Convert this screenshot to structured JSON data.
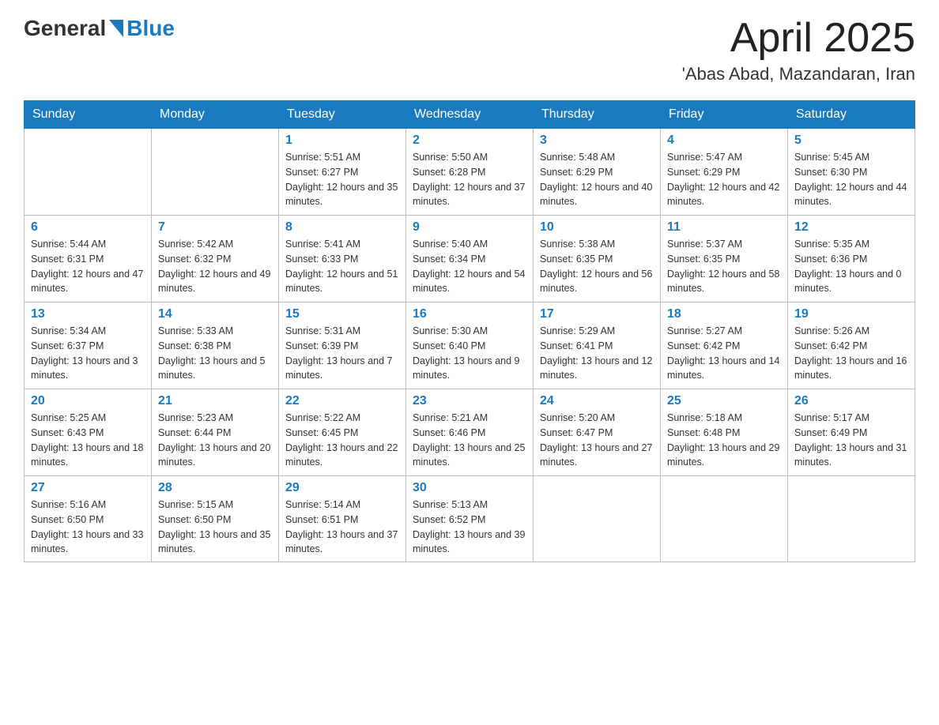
{
  "header": {
    "logo_general": "General",
    "logo_blue": "Blue",
    "month_title": "April 2025",
    "location": "'Abas Abad, Mazandaran, Iran"
  },
  "weekdays": [
    "Sunday",
    "Monday",
    "Tuesday",
    "Wednesday",
    "Thursday",
    "Friday",
    "Saturday"
  ],
  "weeks": [
    [
      null,
      null,
      {
        "day": "1",
        "sunrise": "5:51 AM",
        "sunset": "6:27 PM",
        "daylight": "12 hours and 35 minutes."
      },
      {
        "day": "2",
        "sunrise": "5:50 AM",
        "sunset": "6:28 PM",
        "daylight": "12 hours and 37 minutes."
      },
      {
        "day": "3",
        "sunrise": "5:48 AM",
        "sunset": "6:29 PM",
        "daylight": "12 hours and 40 minutes."
      },
      {
        "day": "4",
        "sunrise": "5:47 AM",
        "sunset": "6:29 PM",
        "daylight": "12 hours and 42 minutes."
      },
      {
        "day": "5",
        "sunrise": "5:45 AM",
        "sunset": "6:30 PM",
        "daylight": "12 hours and 44 minutes."
      }
    ],
    [
      {
        "day": "6",
        "sunrise": "5:44 AM",
        "sunset": "6:31 PM",
        "daylight": "12 hours and 47 minutes."
      },
      {
        "day": "7",
        "sunrise": "5:42 AM",
        "sunset": "6:32 PM",
        "daylight": "12 hours and 49 minutes."
      },
      {
        "day": "8",
        "sunrise": "5:41 AM",
        "sunset": "6:33 PM",
        "daylight": "12 hours and 51 minutes."
      },
      {
        "day": "9",
        "sunrise": "5:40 AM",
        "sunset": "6:34 PM",
        "daylight": "12 hours and 54 minutes."
      },
      {
        "day": "10",
        "sunrise": "5:38 AM",
        "sunset": "6:35 PM",
        "daylight": "12 hours and 56 minutes."
      },
      {
        "day": "11",
        "sunrise": "5:37 AM",
        "sunset": "6:35 PM",
        "daylight": "12 hours and 58 minutes."
      },
      {
        "day": "12",
        "sunrise": "5:35 AM",
        "sunset": "6:36 PM",
        "daylight": "13 hours and 0 minutes."
      }
    ],
    [
      {
        "day": "13",
        "sunrise": "5:34 AM",
        "sunset": "6:37 PM",
        "daylight": "13 hours and 3 minutes."
      },
      {
        "day": "14",
        "sunrise": "5:33 AM",
        "sunset": "6:38 PM",
        "daylight": "13 hours and 5 minutes."
      },
      {
        "day": "15",
        "sunrise": "5:31 AM",
        "sunset": "6:39 PM",
        "daylight": "13 hours and 7 minutes."
      },
      {
        "day": "16",
        "sunrise": "5:30 AM",
        "sunset": "6:40 PM",
        "daylight": "13 hours and 9 minutes."
      },
      {
        "day": "17",
        "sunrise": "5:29 AM",
        "sunset": "6:41 PM",
        "daylight": "13 hours and 12 minutes."
      },
      {
        "day": "18",
        "sunrise": "5:27 AM",
        "sunset": "6:42 PM",
        "daylight": "13 hours and 14 minutes."
      },
      {
        "day": "19",
        "sunrise": "5:26 AM",
        "sunset": "6:42 PM",
        "daylight": "13 hours and 16 minutes."
      }
    ],
    [
      {
        "day": "20",
        "sunrise": "5:25 AM",
        "sunset": "6:43 PM",
        "daylight": "13 hours and 18 minutes."
      },
      {
        "day": "21",
        "sunrise": "5:23 AM",
        "sunset": "6:44 PM",
        "daylight": "13 hours and 20 minutes."
      },
      {
        "day": "22",
        "sunrise": "5:22 AM",
        "sunset": "6:45 PM",
        "daylight": "13 hours and 22 minutes."
      },
      {
        "day": "23",
        "sunrise": "5:21 AM",
        "sunset": "6:46 PM",
        "daylight": "13 hours and 25 minutes."
      },
      {
        "day": "24",
        "sunrise": "5:20 AM",
        "sunset": "6:47 PM",
        "daylight": "13 hours and 27 minutes."
      },
      {
        "day": "25",
        "sunrise": "5:18 AM",
        "sunset": "6:48 PM",
        "daylight": "13 hours and 29 minutes."
      },
      {
        "day": "26",
        "sunrise": "5:17 AM",
        "sunset": "6:49 PM",
        "daylight": "13 hours and 31 minutes."
      }
    ],
    [
      {
        "day": "27",
        "sunrise": "5:16 AM",
        "sunset": "6:50 PM",
        "daylight": "13 hours and 33 minutes."
      },
      {
        "day": "28",
        "sunrise": "5:15 AM",
        "sunset": "6:50 PM",
        "daylight": "13 hours and 35 minutes."
      },
      {
        "day": "29",
        "sunrise": "5:14 AM",
        "sunset": "6:51 PM",
        "daylight": "13 hours and 37 minutes."
      },
      {
        "day": "30",
        "sunrise": "5:13 AM",
        "sunset": "6:52 PM",
        "daylight": "13 hours and 39 minutes."
      },
      null,
      null,
      null
    ]
  ]
}
